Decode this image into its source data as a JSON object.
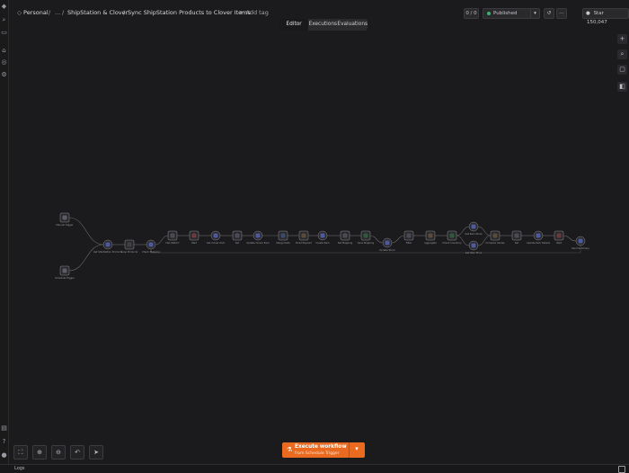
{
  "breadcrumb": {
    "project": "Personal",
    "separator": "/",
    "folder_menu": "...",
    "folder": "ShipStation & Clover",
    "separator2": "/",
    "workflow_name": "Sync ShipStation Products to Clover Items",
    "add_tag": "+ Add tag"
  },
  "header_actions": {
    "version_badge": "0 / 0",
    "published_label": "Published",
    "github_label": "Star",
    "github_count": "150,047",
    "more_icon": "more-icon",
    "history_icon": "history-icon"
  },
  "tabs": [
    "Editor",
    "Executions",
    "Evaluations"
  ],
  "active_tab": "Editor",
  "right_toolbar": [
    "plus-icon",
    "search-icon",
    "sticky-note-icon",
    "panel-icon"
  ],
  "bottom_controls": [
    "fit-view-icon",
    "zoom-in-icon",
    "zoom-out-icon",
    "undo-icon",
    "pointer-icon"
  ],
  "execute": {
    "title": "Execute workflow",
    "subtitle": "from Schedule Trigger",
    "icon": "flask-icon"
  },
  "status_bar": {
    "logs_label": "Logs"
  },
  "accent_color": "#ea6a1f",
  "workflow_nodes": [
    {
      "id": "n1",
      "label": "Manual trigger",
      "kind": "trigger"
    },
    {
      "id": "n2",
      "label": "Schedule Trigger",
      "kind": "trigger"
    },
    {
      "id": "n3",
      "label": "Get ShipStation Products",
      "kind": "http"
    },
    {
      "id": "n4",
      "label": "Loop Products",
      "kind": "loop"
    },
    {
      "id": "n5",
      "label": "Check Mapping",
      "kind": "http"
    },
    {
      "id": "n6",
      "label": "Has Match?",
      "kind": "if"
    },
    {
      "id": "n7",
      "label": "Wait",
      "kind": "wait"
    },
    {
      "id": "n8",
      "label": "Get Clover Item",
      "kind": "http"
    },
    {
      "id": "n9",
      "label": "Set",
      "kind": "set"
    },
    {
      "id": "n10",
      "label": "Update Clover Item",
      "kind": "http"
    },
    {
      "id": "n11",
      "label": "Merge Data",
      "kind": "merge"
    },
    {
      "id": "n12",
      "label": "Build Payload",
      "kind": "code"
    },
    {
      "id": "n13",
      "label": "Create Item",
      "kind": "http"
    },
    {
      "id": "n14",
      "label": "Set Mapping",
      "kind": "set"
    },
    {
      "id": "n15",
      "label": "Save Mapping",
      "kind": "sheet"
    },
    {
      "id": "n16",
      "label": "Update Stock",
      "kind": "http"
    },
    {
      "id": "n17",
      "label": "Filter",
      "kind": "filter"
    },
    {
      "id": "n18",
      "label": "Aggregate",
      "kind": "code"
    },
    {
      "id": "n19",
      "label": "Check Inventory",
      "kind": "sheet"
    },
    {
      "id": "n20",
      "label": "Get Item Stock",
      "kind": "http"
    },
    {
      "id": "n21",
      "label": "Get Item Price",
      "kind": "http"
    },
    {
      "id": "n22",
      "label": "Compare Values",
      "kind": "code"
    },
    {
      "id": "n23",
      "label": "Set",
      "kind": "set"
    },
    {
      "id": "n24",
      "label": "Update Item Details",
      "kind": "http"
    },
    {
      "id": "n25",
      "label": "Wait",
      "kind": "wait"
    },
    {
      "id": "n26",
      "label": "Send Summary",
      "kind": "http"
    }
  ]
}
